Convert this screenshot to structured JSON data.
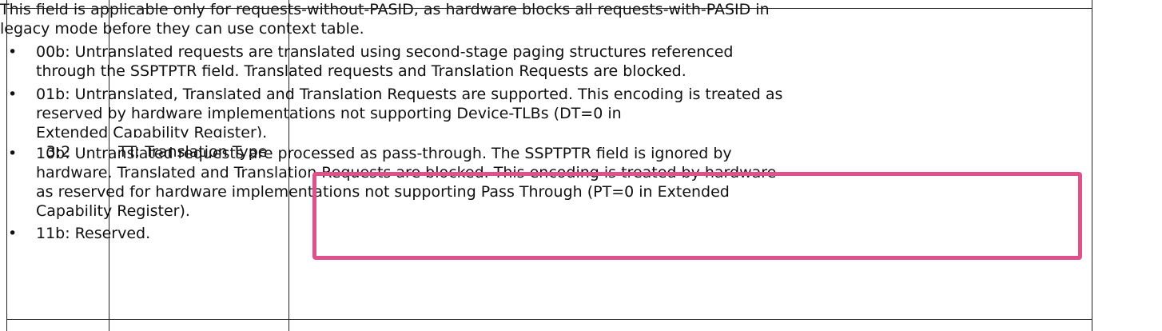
{
  "table": {
    "bits": "3:2",
    "field_name": "TT: Translation Type",
    "description_intro": "This field is applicable only for requests-without-PASID, as hardware blocks all requests-with-PASID in legacy mode before they can use context table.",
    "items": [
      {
        "text": "00b: Untranslated requests are translated using second-stage paging structures referenced through the SSPTPTR field. Translated requests and Translation Requests are blocked."
      },
      {
        "text": "01b: Untranslated, Translated and Translation Requests are supported. This encoding is treated as reserved by hardware implementations not supporting Device-TLBs (DT=0 in",
        "clipped_tail": "Extended Capability Register)."
      },
      {
        "text": "10b: Untranslated requests are processed as pass-through. The SSPTPTR field is ignored by hardware. Translated and Translation Requests are blocked. This encoding is treated by hardware as reserved for hardware implementations not supporting Pass Through (PT=0 in Extended Capability Register)."
      },
      {
        "text": "11b: Reserved."
      }
    ],
    "bullet": "•"
  },
  "highlight": {
    "color": "#e0508a",
    "target": "item-10b"
  }
}
